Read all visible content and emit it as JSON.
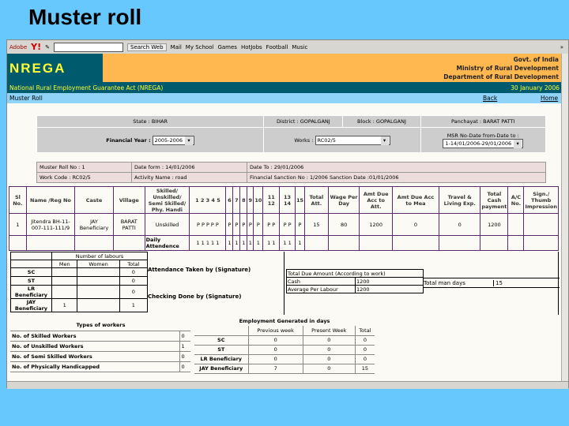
{
  "slide_title": "Muster roll",
  "toolbar": {
    "adobe": "Adobe",
    "yahoo": "Y!",
    "search": "Search Web",
    "mail": "Mail",
    "myschool": "My School",
    "games": "Games",
    "hotjobs": "HotJobs",
    "football": "Football",
    "music": "Music",
    "more": "»"
  },
  "header": {
    "logo": "NREGA",
    "gov": "Govt. of India",
    "ministry": "Ministry of Rural Development",
    "dept": "Department of Rural Development",
    "act": "National Rural Employment Guarantee Act (NREGA)",
    "date": "30 January 2006",
    "page": "Muster Roll",
    "back": "Back",
    "home": "Home"
  },
  "filters": {
    "state": "State : BIHAR",
    "district": "District : GOPALGANJ",
    "block": "Block : GOPALGANJ",
    "panchayat": "Panchayat : BARAT PATTI",
    "fy_label": "Financial Year :",
    "fy_value": "2005-2006",
    "works_label": "Works :",
    "works_value": "RC02/5",
    "msr_label": "MSR No-Date from-Date to :",
    "msr_value": "1-14/01/2006-29/01/2006"
  },
  "roll": {
    "no": "Muster Roll No : 1",
    "from": "Date form : 14/01/2006",
    "to": "Date To : 29/01/2006",
    "work_code": "Work Code : RC02/5",
    "activity": "Activity Name : road",
    "sanction": "Financial Sanction No : 1/2006     Sanction Date :01/01/2006"
  },
  "main_table": {
    "headers": [
      "Sl No.",
      "Name /Reg No",
      "Caste",
      "Village",
      "Skilled/ Unskilled/ Semi Skilled/ Phy. Handi",
      "1 2 3 4 5",
      "6",
      "7",
      "8",
      "9",
      "10",
      "11 12",
      "13 14",
      "15",
      "Total Att.",
      "Wage Per Day",
      "Amt Due Acc to Att.",
      "Amt Due Acc to Mea",
      "Travel & Living Exp.",
      "Total Cash payment",
      "A/C No.",
      "Sign./ Thumb Impression"
    ],
    "row": [
      "1",
      "Jitendra BH-11-007-111-111/9",
      "JAY Beneficiary",
      "BARAT PATTI",
      "Unskilled",
      "P P P P P",
      "P",
      "P",
      "P",
      "P",
      "P",
      "P P",
      "P P",
      "P",
      "15",
      "80",
      "1200",
      "0",
      "0",
      "1200",
      "",
      ""
    ],
    "attendance_label": "Daily Attendence",
    "attendance": [
      "1 1 1 1 1",
      "1",
      "1",
      "1",
      "1",
      "1",
      "1 1",
      "1 1",
      "1"
    ]
  },
  "labours": {
    "title": "Number of labours",
    "cols": [
      "Men",
      "Women",
      "Total"
    ],
    "rows": [
      {
        "label": "SC",
        "men": "",
        "women": "",
        "total": "0"
      },
      {
        "label": "ST",
        "men": "",
        "women": "",
        "total": "0"
      },
      {
        "label": "LR Beneficiary",
        "men": "",
        "women": "",
        "total": "0"
      },
      {
        "label": "JAY Beneficiary",
        "men": "1",
        "women": "",
        "total": "1"
      }
    ]
  },
  "signatures": {
    "attendance": "Attendance Taken by (Signature)",
    "checking": "Checking Done by (Signature)"
  },
  "due": {
    "title": "Total Due Amount (According to work)",
    "cash_label": "Cash",
    "cash": "1200",
    "avg_label": "Average Per Labour",
    "avg": "1200",
    "mandays_label": "Total man days",
    "mandays": "15"
  },
  "workers": {
    "title": "Types of workers",
    "rows": [
      {
        "label": "No. of Skilled Workers",
        "v": "0"
      },
      {
        "label": "No. of Unskilled Workers",
        "v": "1"
      },
      {
        "label": "No. of Semi Skilled Workers",
        "v": "0"
      },
      {
        "label": "No. of Physically Handicapped",
        "v": "0"
      }
    ]
  },
  "employment": {
    "title": "Employment Generated in days",
    "cols": [
      "Previous week",
      "Present Week",
      "Total"
    ],
    "rows": [
      {
        "label": "SC",
        "p": "0",
        "c": "0",
        "t": "0"
      },
      {
        "label": "ST",
        "p": "0",
        "c": "0",
        "t": "0"
      },
      {
        "label": "LR Beneficiary",
        "p": "0",
        "c": "0",
        "t": "0"
      },
      {
        "label": "JAY Beneficiary",
        "p": "7",
        "c": "0",
        "t": "15"
      }
    ]
  }
}
